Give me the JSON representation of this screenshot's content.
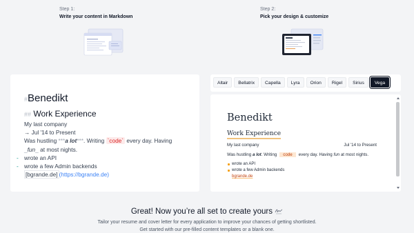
{
  "steps": [
    {
      "num": "Step 1:",
      "title": "Write your content in Markdown"
    },
    {
      "num": "Step 2:",
      "title": "Pick your design & customize"
    }
  ],
  "editor": {
    "h1_marker": "#",
    "name": "Benedikt",
    "h2_marker": "##",
    "section": "Work Experience",
    "company": "My last company",
    "date_line": "→ Jul '14 to Present",
    "was_hustling": "Was hustling",
    "bold_open": "***",
    "bold_text": "a lot",
    "bold_close": "***",
    "writing": ". Writing",
    "code_text": "`code`",
    "every_day": "every day. Having",
    "em_open": "_",
    "em_text": "fun",
    "em_close": "_",
    "at_most": "at most nights.",
    "bullet_marker": "-",
    "bullets": [
      "wrote an API",
      "wrote a few Admin backends"
    ],
    "link_text": "[bgrande.de]",
    "link_url": "(https://bgrande.de)"
  },
  "themes": {
    "tabs": [
      "Altair",
      "Bellatrix",
      "Capella",
      "Lyra",
      "Orion",
      "Rigel",
      "Sirius",
      "Vega"
    ],
    "active": "Vega"
  },
  "preview": {
    "name": "Benedikt",
    "section": "Work Experience",
    "company": "My last company",
    "date": "Jul '14 to Present",
    "text_1": "Was hustling",
    "bold": "a lot",
    "text_2": ". Writing",
    "code": "code",
    "text_3": "every day. Having",
    "italic": "fun",
    "text_4": "at most nights.",
    "bullets": [
      "wrote an API",
      "wrote a few Admin backends"
    ],
    "link": "bgrande.de"
  },
  "cta": {
    "title": "Great! Now you’re all set to create yours",
    "title_icon": "signature-icon",
    "line1": "Tailor your resume and cover letter for every application to improve your chances of getting shortlisted.",
    "line2": "Get started with our pre-filled content templates or a blank one."
  }
}
